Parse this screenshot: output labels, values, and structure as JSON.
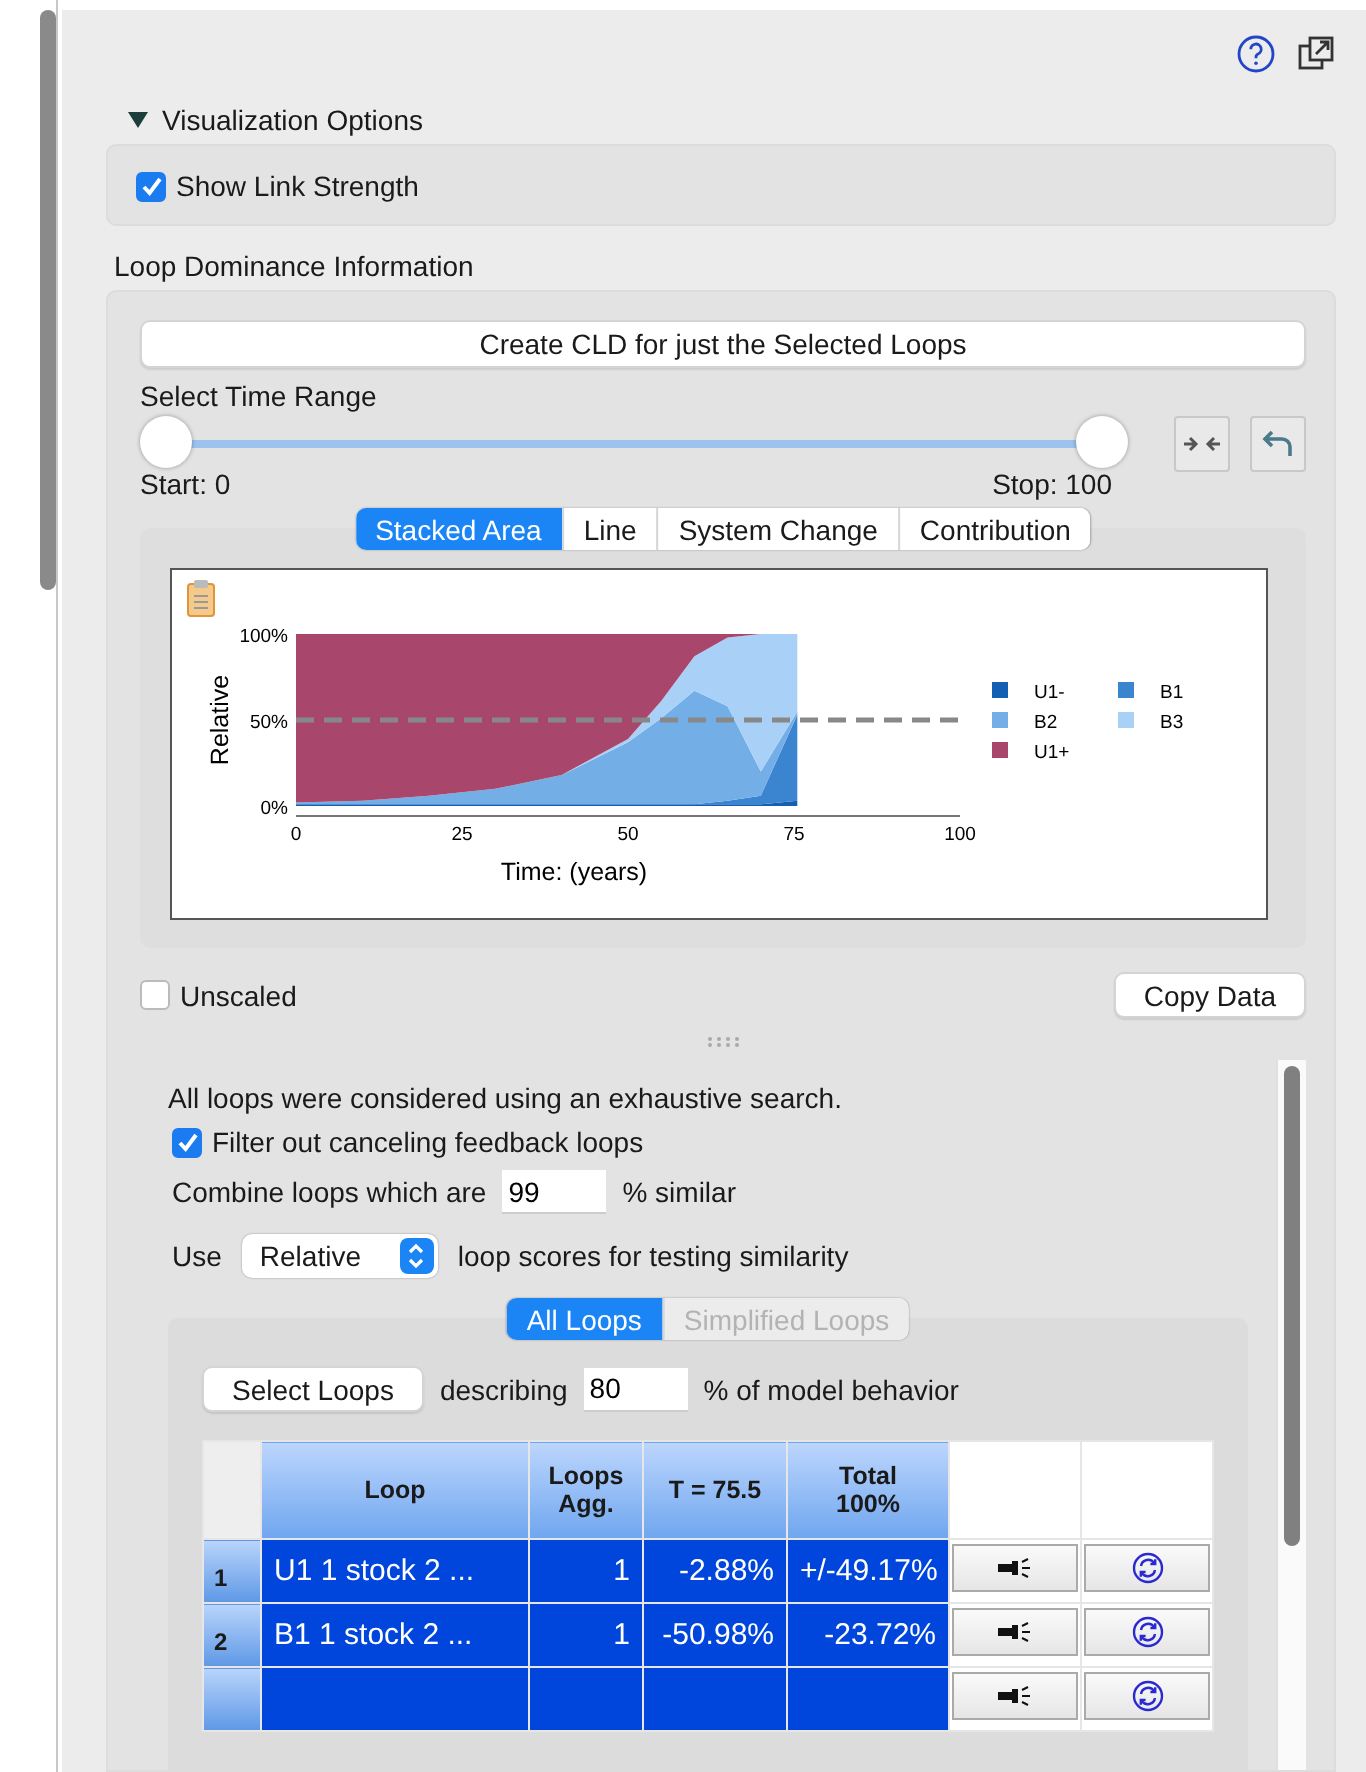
{
  "visualization_options": {
    "title": "Visualization Options",
    "expanded": true,
    "show_link_strength": {
      "label": "Show Link Strength",
      "checked": true
    }
  },
  "loop_dominance": {
    "title": "Loop Dominance Information",
    "create_cld_button": "Create CLD for just the Selected Loops",
    "time_range": {
      "label": "Select Time Range",
      "start": {
        "level": 0,
        "label": "Start: 0"
      },
      "stop": {
        "level": 1,
        "label": "Stop: 100"
      }
    },
    "chart_tabs": [
      {
        "label": "Stacked Area",
        "selected": true
      },
      {
        "label": "Line",
        "selected": false
      },
      {
        "label": "System Change",
        "selected": false
      },
      {
        "label": "Contribution",
        "selected": false
      }
    ],
    "chart": {
      "chart_data": {
        "type": "area",
        "stacked": true,
        "xlabel": "Time: (years)",
        "ylabel": "Relative",
        "x": [
          0,
          10,
          20,
          30,
          40,
          50,
          55,
          60,
          65,
          70,
          75.5
        ],
        "series": [
          {
            "name": "U1-",
            "color": "#125fb3",
            "values": [
              1,
              1,
              1,
              1,
              1,
              1,
              1,
              1,
              1,
              1,
              3
            ]
          },
          {
            "name": "B1",
            "color": "#3b84d0",
            "values": [
              null,
              null,
              null,
              null,
              null,
              null,
              null,
              0,
              2,
              5,
              50
            ]
          },
          {
            "name": "B2",
            "color": "#74aee6",
            "values": [
              1,
              2,
              5,
              9,
              17,
              36,
              50,
              66,
              55,
              14,
              2
            ]
          },
          {
            "name": "B3",
            "color": "#a9d1f8",
            "values": [
              null,
              null,
              null,
              null,
              0,
              2,
              10,
              20,
              40,
              80,
              45
            ]
          },
          {
            "name": "U1+",
            "color": "#a8476b",
            "values": [
              98,
              97,
              94,
              90,
              82,
              61,
              39,
              13,
              2,
              0,
              0
            ]
          }
        ],
        "xlim": [
          0,
          100
        ],
        "ylim": [
          0,
          100
        ],
        "xticks": [
          0,
          25,
          50,
          75,
          100
        ],
        "yticks": [
          {
            "value": 0,
            "label": "0%"
          },
          {
            "value": 50,
            "label": "50%"
          },
          {
            "value": 100,
            "label": "100%"
          }
        ],
        "ref_lines": [
          {
            "axis": "y",
            "value": 50
          }
        ],
        "legend": "right"
      }
    },
    "unscaled": {
      "label": "Unscaled",
      "checked": false
    },
    "copy_data_button": "Copy Data",
    "search_note": "All loops were considered using an exhaustive search.",
    "filter": {
      "label": "Filter out canceling feedback loops",
      "checked": true
    },
    "combine": {
      "prefix": "Combine loops which are",
      "value": "99",
      "suffix": "% similar"
    },
    "use": {
      "prefix": "Use",
      "value": "Relative",
      "suffix": "loop scores for testing similarity"
    },
    "loop_tabs": [
      {
        "label": "All Loops",
        "selected": true,
        "disabled": false
      },
      {
        "label": "Simplified Loops",
        "selected": false,
        "disabled": true
      }
    ],
    "select": {
      "button": "Select Loops",
      "prefix": "describing",
      "value": "80",
      "suffix": "% of model behavior"
    },
    "table": {
      "columns": [
        "Loop",
        "Loops\nAgg.",
        "T = 75.5",
        "Total\n100%"
      ],
      "rows": [
        {
          "number": "1",
          "loop": "U1 1 stock 2 ...",
          "loops_agg": "1",
          "t": "-2.88%",
          "total": "+/-49.17%",
          "selected": true
        },
        {
          "number": "2",
          "loop": "B1 1 stock 2 ...",
          "loops_agg": "1",
          "t": "-50.98%",
          "total": "-23.72%",
          "selected": true
        },
        {
          "selected": true
        }
      ]
    }
  }
}
